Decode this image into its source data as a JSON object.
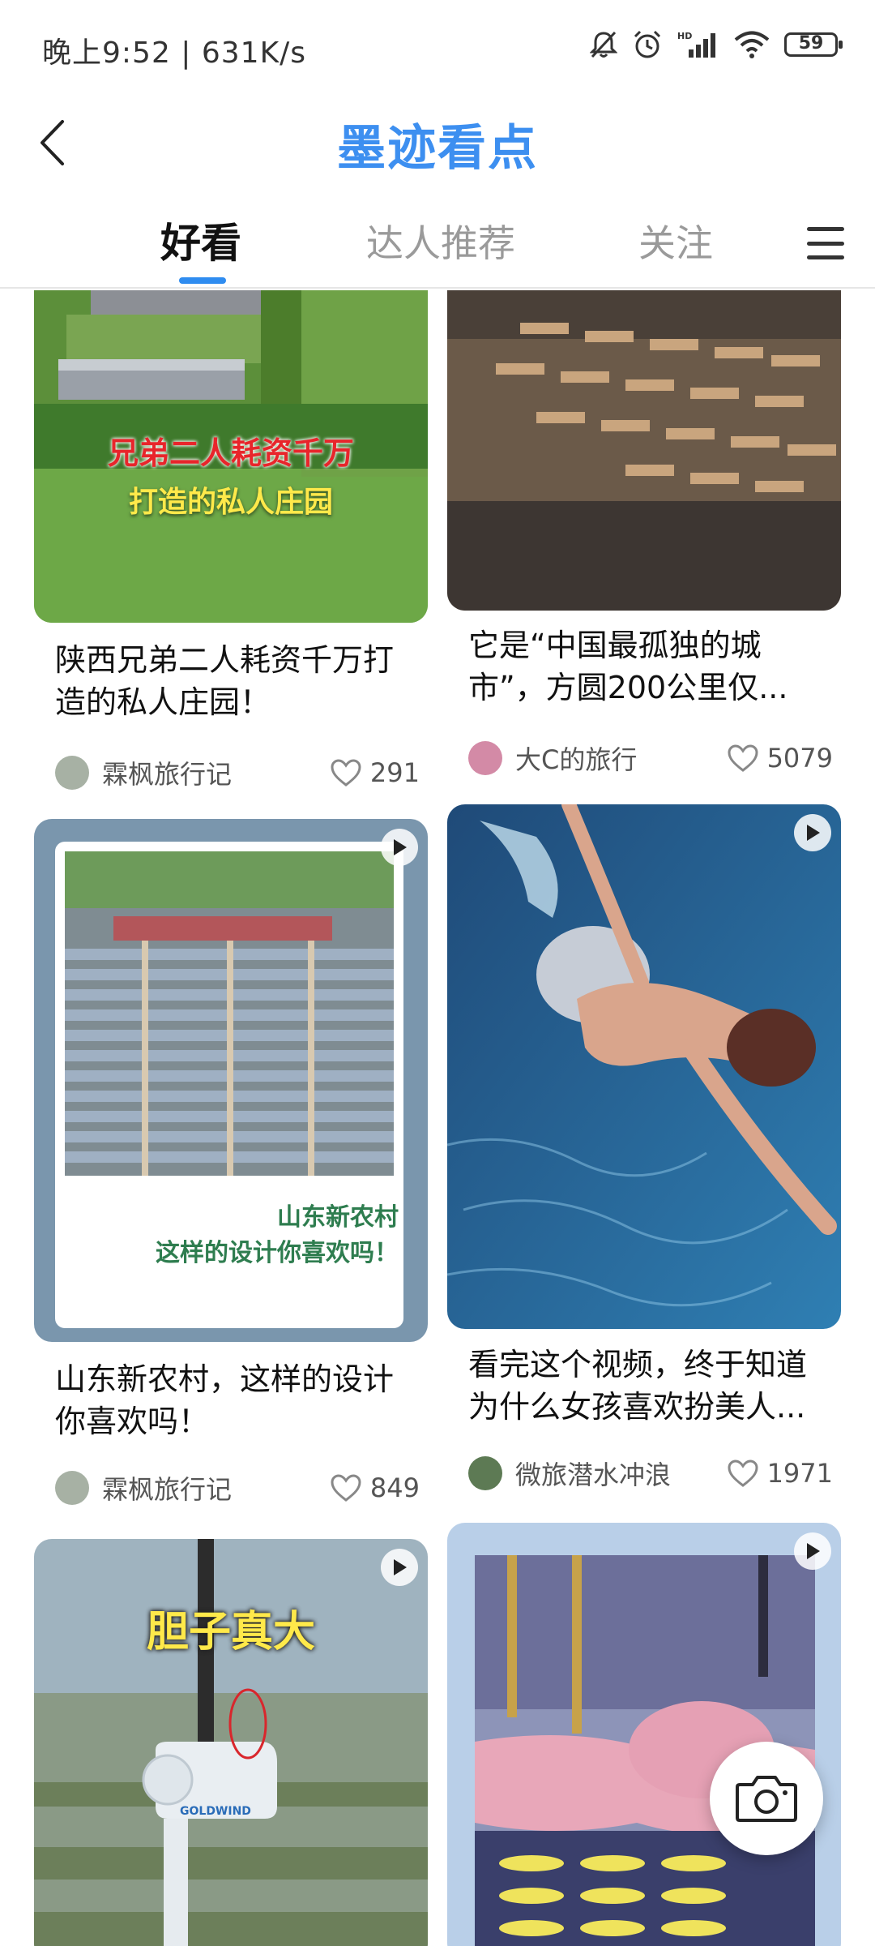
{
  "status_bar": {
    "time_speed": "晚上9:52 | 631K/s",
    "battery": "59",
    "icons": [
      "mute-icon",
      "alarm-icon",
      "hd-signal-icon",
      "wifi-icon",
      "battery-icon"
    ]
  },
  "header": {
    "title": "墨迹看点",
    "back_icon": "chevron-left-icon"
  },
  "tabs": [
    {
      "label": "好看",
      "active": true
    },
    {
      "label": "达人推荐",
      "active": false
    },
    {
      "label": "关注",
      "active": false
    }
  ],
  "menu_icon": "hamburger-menu-icon",
  "feed": {
    "cards": [
      {
        "title": "陕西兄弟二人耗资千万打造的私人庄园！",
        "overlay_lines": [
          "兄弟二人耗资千万",
          "打造的私人庄园"
        ],
        "author": "霖枫旅行记",
        "likes": "291",
        "video": false
      },
      {
        "title": "它是“中国最孤独的城市”，方圆200公里仅...",
        "author": "大C的旅行",
        "likes": "5079",
        "video": false
      },
      {
        "title": "山东新农村，这样的设计你喜欢吗！",
        "overlay_lines": [
          "山东新农村",
          "这样的设计你喜欢吗！"
        ],
        "author": "霖枫旅行记",
        "likes": "849",
        "video": true
      },
      {
        "title": "看完这个视频，终于知道为什么女孩喜欢扮美人...",
        "author": "微旅潜水冲浪",
        "likes": "1971",
        "video": true
      },
      {
        "title": "",
        "overlay_lines": [
          "胆子真大"
        ],
        "brand_text": "GOLDWIND",
        "video": true
      },
      {
        "title": "",
        "video": true
      }
    ]
  },
  "fab": {
    "icon": "camera-icon"
  },
  "colors": {
    "accent": "#2f8cf0",
    "title_blue": "#3d8ff0",
    "overlay_red": "#e8252b",
    "overlay_yellow": "#ffe94a",
    "overlay_green": "#2e7d4f"
  }
}
